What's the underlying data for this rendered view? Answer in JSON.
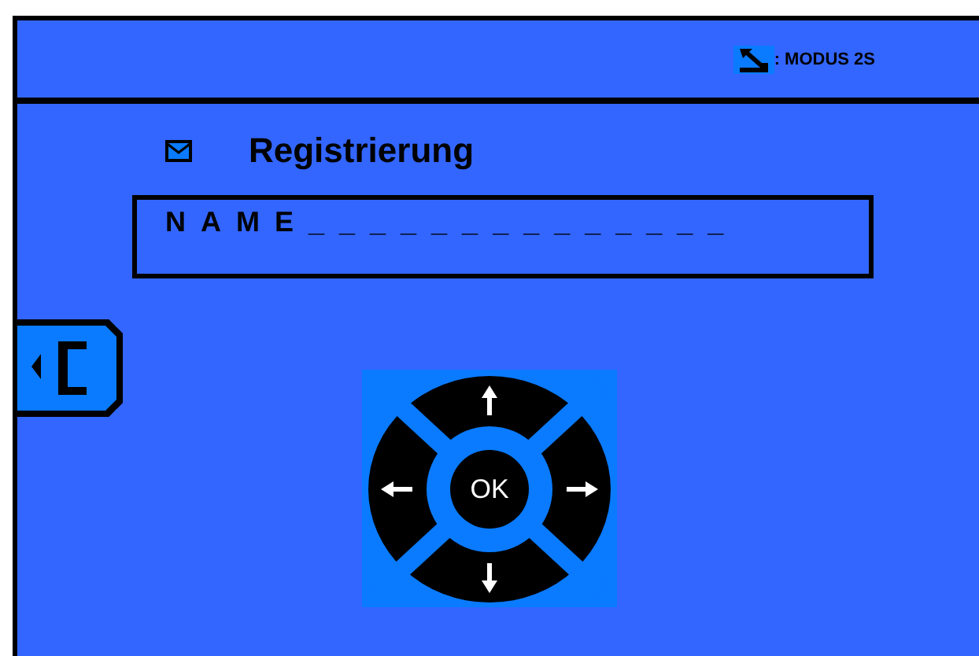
{
  "header": {
    "mode_label": ": MODUS 2S"
  },
  "title": {
    "text": "Registrierung"
  },
  "name_field": {
    "value": "NAME______________"
  },
  "keypad": {
    "ok_label": "OK"
  }
}
